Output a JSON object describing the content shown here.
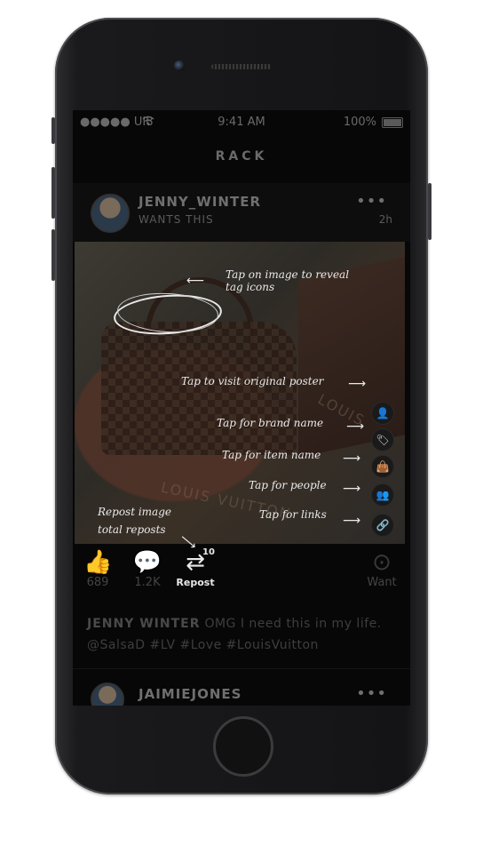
{
  "status_bar": {
    "carrier": "●●●●● UI8",
    "wifi_icon": "wifi-icon",
    "time": "9:41 AM",
    "battery": "100%"
  },
  "nav": {
    "title": "RACK"
  },
  "post": {
    "username": "JENNY_WINTER",
    "subtitle": "WANTS THIS",
    "more": "•••",
    "time": "2h",
    "photo_text": [
      "LOUIS VUITTON",
      "LOUIS"
    ]
  },
  "hints": {
    "reveal": "Tap on image to reveal\ntag icons",
    "poster": "Tap to visit original poster",
    "brand": "Tap for brand name",
    "item": "Tap for item name",
    "people": "Tap for people",
    "links": "Tap for links",
    "repost": "Repost image\ntotal reposts"
  },
  "actions": {
    "like_count": "689",
    "comment_count": "1.2K",
    "repost_label": "Repost",
    "repost_count": "10",
    "want_label": "Want"
  },
  "caption": {
    "user": "JENNY WINTER",
    "text": "OMG I need this in my life. @SalsaD #LV #Love #LouisVuitton"
  },
  "next_post": {
    "username": "JAIMIEJONES",
    "more": "•••"
  }
}
